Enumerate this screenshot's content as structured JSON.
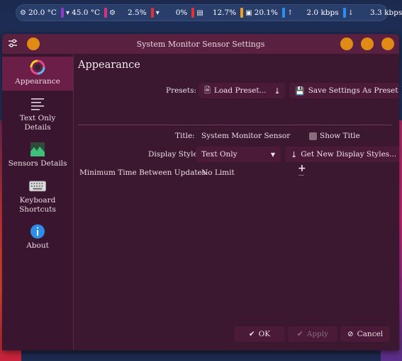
{
  "panel": {
    "cpu_temp": "20.0 °C",
    "gpu_temp": "45.0 °C",
    "cpu_load": "2.5%",
    "gpu_load": "0%",
    "mem": "12.7%",
    "swap": "20.1%",
    "upload": "2.0 kbps",
    "download": "3.3 kbps",
    "colors": {
      "purple": "#8e3cc7",
      "magenta": "#e0307a",
      "red": "#e33030",
      "orange": "#f0a020",
      "blue": "#2a8ef0"
    }
  },
  "window": {
    "title": "System Monitor Sensor Settings",
    "accent": "#e18a16"
  },
  "sidebar": {
    "items": [
      {
        "label": "Appearance",
        "icon": "appearance-icon"
      },
      {
        "label": "Text Only Details",
        "icon": "text-details-icon"
      },
      {
        "label": "Sensors Details",
        "icon": "sensors-icon"
      },
      {
        "label": "Keyboard Shortcuts",
        "icon": "keyboard-icon"
      },
      {
        "label": "About",
        "icon": "info-icon"
      }
    ]
  },
  "main": {
    "heading": "Appearance",
    "presets_label": "Presets:",
    "load_preset": "Load Preset...",
    "save_preset": "Save Settings As Preset",
    "title_label": "Title:",
    "title_value": "System Monitor Sensor",
    "show_title": "Show Title",
    "display_style_label": "Display Style:",
    "display_style_value": "Text Only",
    "get_new_styles": "Get New Display Styles...",
    "min_time_label": "Minimum Time Between Updates:",
    "min_time_value": "No Limit"
  },
  "footer": {
    "ok": "OK",
    "apply": "Apply",
    "cancel": "Cancel"
  }
}
